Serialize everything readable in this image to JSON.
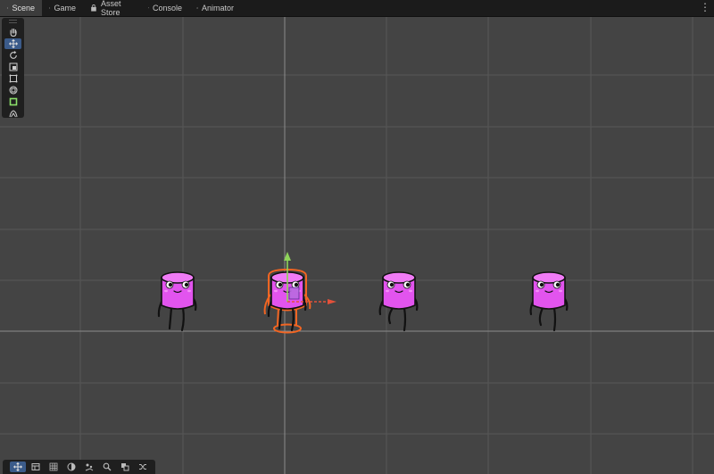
{
  "tabs": [
    {
      "label": "Scene",
      "icon": "scene-icon",
      "active": true
    },
    {
      "label": "Game",
      "icon": "gamepad-icon",
      "active": false
    },
    {
      "label": "Asset Store",
      "icon": "store-bag-icon",
      "active": false
    },
    {
      "label": "Console",
      "icon": "console-icon",
      "active": false
    },
    {
      "label": "Animator",
      "icon": "animator-icon",
      "active": false
    }
  ],
  "more_menu": "⋮",
  "toolbox": [
    "hand-tool",
    "move-tool",
    "rotate-tool",
    "scale-tool",
    "rect-tool",
    "transform-tool",
    "custom-tool",
    "bone-tool"
  ],
  "toolbox_selected": "move-tool",
  "bottom_tools": [
    "move-view",
    "layers",
    "grid",
    "lighting",
    "effects",
    "search",
    "gizmos",
    "shuffle"
  ],
  "bottom_selected": "move-view",
  "scene": {
    "characters": [
      "character-1",
      "character-2-selected",
      "character-3",
      "character-4"
    ],
    "selected": "character-2-selected"
  },
  "colors": {
    "background": "#444444",
    "grid": "#575757",
    "axis": "#8c8c8c",
    "character": "#e254ee",
    "selection": "#f26522",
    "gizmo_y": "#8fd35a",
    "gizmo_x": "#e4513a"
  }
}
